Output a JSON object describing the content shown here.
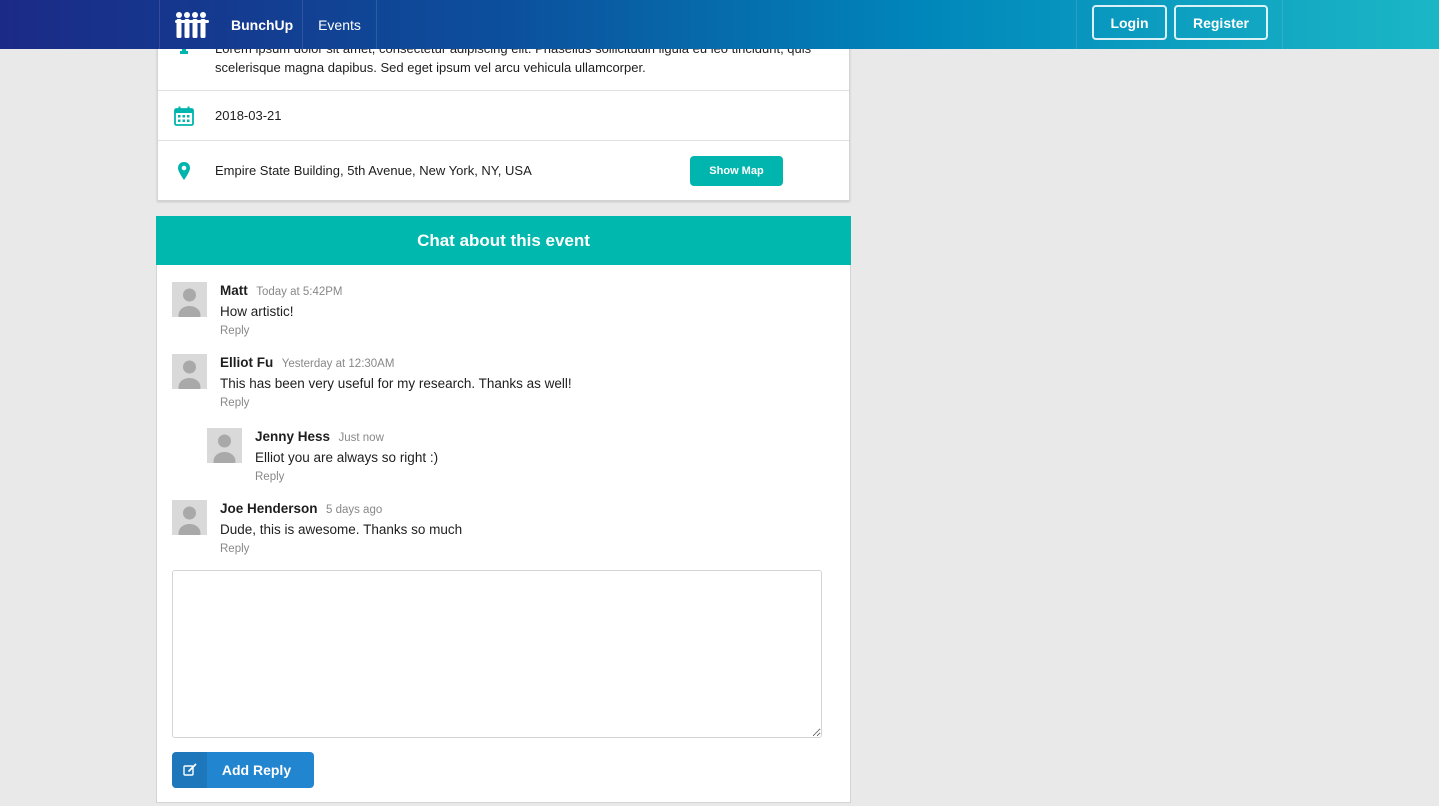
{
  "nav": {
    "brand": "BunchUp",
    "events": "Events",
    "login": "Login",
    "register": "Register"
  },
  "details": {
    "description": "Lorem ipsum dolor sit amet, consectetur adipiscing elit. Phasellus sollicitudin ligula eu leo tincidunt, quis scelerisque magna dapibus. Sed eget ipsum vel arcu vehicula ullamcorper.",
    "date": "2018-03-21",
    "location": "Empire State Building, 5th Avenue, New York, NY, USA",
    "show_map": "Show Map"
  },
  "chat": {
    "title": "Chat about this event",
    "comments": [
      {
        "author": "Matt",
        "time": "Today at 5:42PM",
        "text": "How artistic!",
        "reply": "Reply"
      },
      {
        "author": "Elliot Fu",
        "time": "Yesterday at 12:30AM",
        "text": "This has been very useful for my research. Thanks as well!",
        "reply": "Reply"
      },
      {
        "author": "Jenny Hess",
        "time": "Just now",
        "text": "Elliot you are always so right :)",
        "reply": "Reply"
      },
      {
        "author": "Joe Henderson",
        "time": "5 days ago",
        "text": "Dude, this is awesome. Thanks so much",
        "reply": "Reply"
      }
    ],
    "reply_value": "",
    "add_reply": "Add Reply"
  },
  "colors": {
    "teal": "#00b5ad",
    "blue": "#2185d0",
    "nav_start": "#1b2a86",
    "nav_end": "#1bb7c6"
  }
}
